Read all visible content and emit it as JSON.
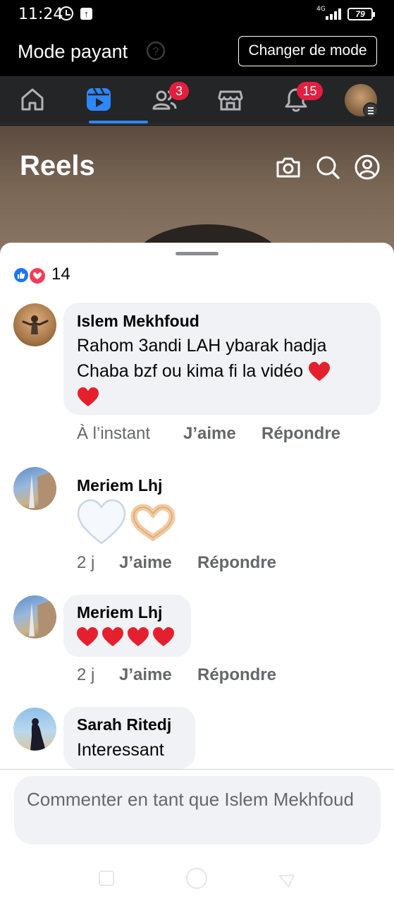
{
  "status_bar": {
    "time": "11:24",
    "network": "4G",
    "battery": "79"
  },
  "header": {
    "title": "Mode payant",
    "switch_button": "Changer de mode"
  },
  "tabs": {
    "friends_badge": "3",
    "notifications_badge": "15",
    "active_tab": "reels",
    "accent_color": "#2d88ff",
    "badge_color": "#e41e3f"
  },
  "reels": {
    "title": "Reels"
  },
  "reactions": {
    "count": "14"
  },
  "comments": [
    {
      "author": "Islem Mekhfoud",
      "text_lines": [
        "Rahom 3andi LAH ybarak hadja",
        "Chaba bzf ou kima fi la vidéo ❤️",
        "❤️"
      ],
      "time": "À l’instant",
      "like": "J’aime",
      "reply": "Répondre"
    },
    {
      "author": "Meriem Lhj",
      "emojis": "🤍🫶🏻",
      "time": "2 j",
      "like": "J’aime",
      "reply": "Répondre"
    },
    {
      "author": "Meriem Lhj",
      "emojis": "❤️❤️❤️❤️",
      "time": "2 j",
      "like": "J’aime",
      "reply": "Répondre"
    },
    {
      "author": "Sarah Ritedj",
      "text": "Interessant"
    }
  ],
  "composer": {
    "placeholder": "Commenter en tant que Islem Mekhfoud"
  }
}
